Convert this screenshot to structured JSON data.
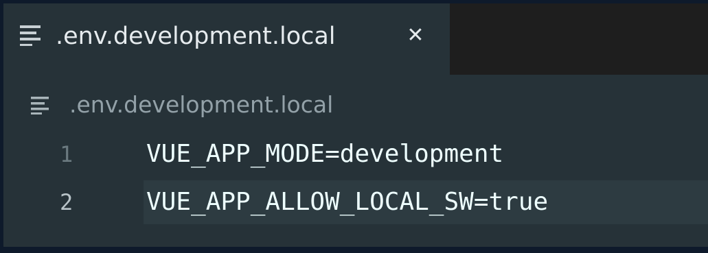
{
  "tab": {
    "icon": "file-lines-icon",
    "title": ".env.development.local",
    "close_glyph": "✕"
  },
  "breadcrumb": {
    "icon": "file-lines-icon",
    "text": ".env.development.local"
  },
  "editor": {
    "lines": [
      {
        "number": "1",
        "text": "VUE_APP_MODE=development"
      },
      {
        "number": "2",
        "text": "VUE_APP_ALLOW_LOCAL_SW=true"
      }
    ]
  },
  "colors": {
    "editor_background": "#263238",
    "tabbar_background": "#1e1e1e",
    "outer_background": "#0e1a2b",
    "text": "#eeffff",
    "line_number": "#6b7a80"
  }
}
